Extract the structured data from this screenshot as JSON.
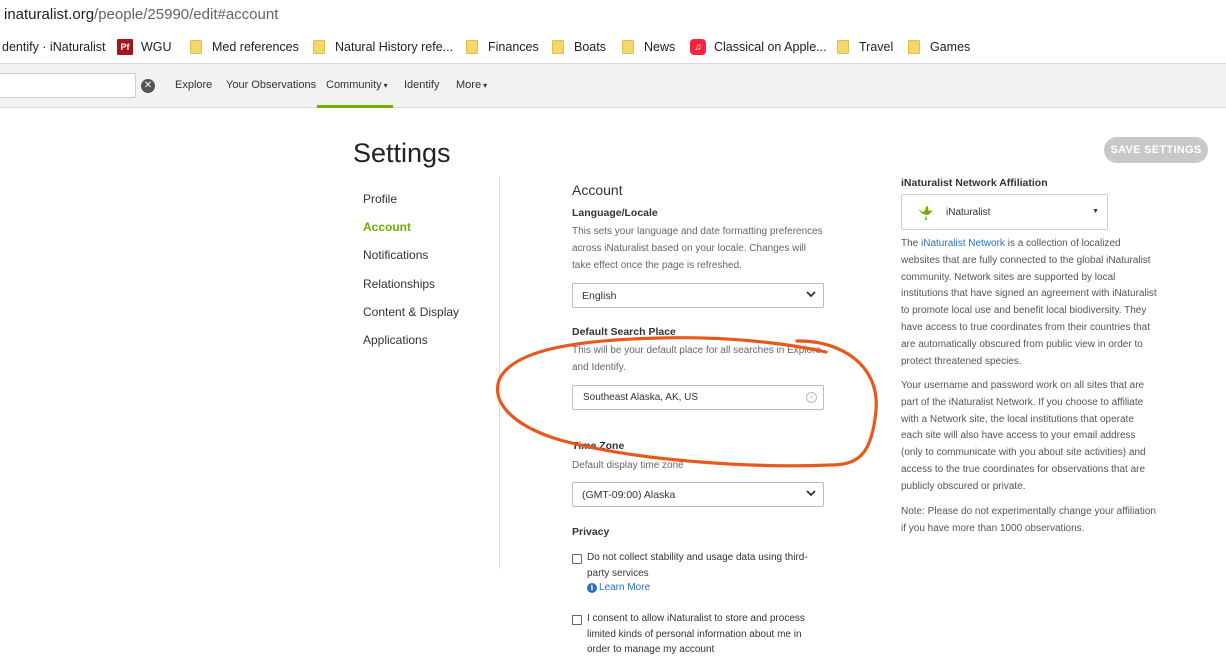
{
  "browser": {
    "url_host": "inaturalist.org",
    "url_path": "/people/25990/edit#account",
    "bookmarks": [
      {
        "label": "dentify · iNaturalist",
        "icon": "none"
      },
      {
        "label": "WGU",
        "icon": "pf-icon"
      },
      {
        "label": "Med references",
        "icon": "folder-icon"
      },
      {
        "label": "Natural History refe...",
        "icon": "folder-icon"
      },
      {
        "label": "Finances",
        "icon": "folder-icon"
      },
      {
        "label": "Boats",
        "icon": "folder-icon"
      },
      {
        "label": "News",
        "icon": "folder-icon"
      },
      {
        "label": "Classical on Apple...",
        "icon": "music-icon"
      },
      {
        "label": "Travel",
        "icon": "folder-icon"
      },
      {
        "label": "Games",
        "icon": "folder-icon"
      }
    ],
    "pf_glyph": "Pf"
  },
  "nav": {
    "search_value": "",
    "clear_glyph": "✕",
    "items": [
      "Explore",
      "Your Observations",
      "Community",
      "Identify",
      "More"
    ],
    "active": "Community",
    "accent": "#74ac00"
  },
  "settings": {
    "title": "Settings",
    "save_label": "SAVE SETTINGS",
    "sidebar": [
      "Profile",
      "Account",
      "Notifications",
      "Relationships",
      "Content & Display",
      "Applications"
    ],
    "active_section": "Account",
    "account": {
      "heading": "Account",
      "language_label": "Language/Locale",
      "language_help": "This sets your language and date formatting preferences across iNaturalist based on your locale. Changes will take effect once the page is refreshed.",
      "language_value": "English",
      "place_label": "Default Search Place",
      "place_help": "This will be your default place for all searches in Explore and Identify.",
      "place_value": "Southeast Alaska, AK, US",
      "timezone_label": "Time Zone",
      "timezone_help": "Default display time zone",
      "timezone_value": "(GMT-09:00) Alaska",
      "privacy_label": "Privacy",
      "privacy_opt1": "Do not collect stability and usage data using third-party services",
      "learn_more": "Learn More",
      "privacy_opt2": "I consent to allow iNaturalist to store and process limited kinds of personal information about me in order to manage my account"
    },
    "network": {
      "title": "iNaturalist Network Affiliation",
      "selected": "iNaturalist",
      "para1_prefix": "The ",
      "para1_link": "iNaturalist Network",
      "para1_rest": " is a collection of localized websites that are fully connected to the global iNaturalist community. Network sites are supported by local institutions that have signed an agreement with iNaturalist to promote local use and benefit local biodiversity. They have access to true coordinates from their countries that are automatically obscured from public view in order to protect threatened species.",
      "para2": "Your username and password work on all sites that are part of the iNaturalist Network. If you choose to affiliate with a Network site, the local institutions that operate each site will also have access to your email address (only to communicate with you about site activities) and access to the true coordinates for observations that are publicly obscured or private.",
      "para3": "Note: Please do not experimentally change your affiliation if you have more than 1000 observations."
    }
  },
  "annotation": {
    "color": "#e8581a",
    "shape": "hand-drawn-ellipse"
  }
}
